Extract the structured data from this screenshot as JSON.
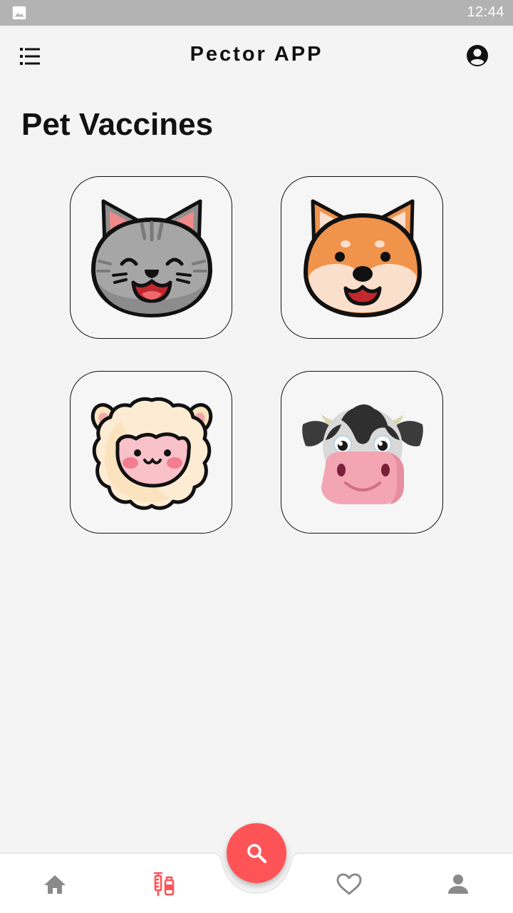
{
  "status_bar": {
    "time": "12:44",
    "notification_icon": "image-icon"
  },
  "app_bar": {
    "title": "Pector APP",
    "menu_icon": "menu-list-icon",
    "account_icon": "account-circle-icon"
  },
  "page": {
    "title": "Pet Vaccines"
  },
  "pets": [
    {
      "animal": "cat",
      "icon": "cat-icon"
    },
    {
      "animal": "dog",
      "icon": "dog-icon"
    },
    {
      "animal": "sheep",
      "icon": "sheep-icon"
    },
    {
      "animal": "cow",
      "icon": "cow-icon"
    }
  ],
  "bottom_nav": {
    "items": [
      {
        "icon": "home-icon",
        "active": false
      },
      {
        "icon": "vaccine-icon",
        "active": true
      },
      {
        "icon": "heart-icon",
        "active": false
      },
      {
        "icon": "person-icon",
        "active": false
      }
    ],
    "fab_icon": "search-icon"
  },
  "colors": {
    "accent": "#ff5457",
    "background": "#f4f4f4",
    "status_bar": "#b3b3b3",
    "nav_inactive": "#8a8a8a"
  }
}
